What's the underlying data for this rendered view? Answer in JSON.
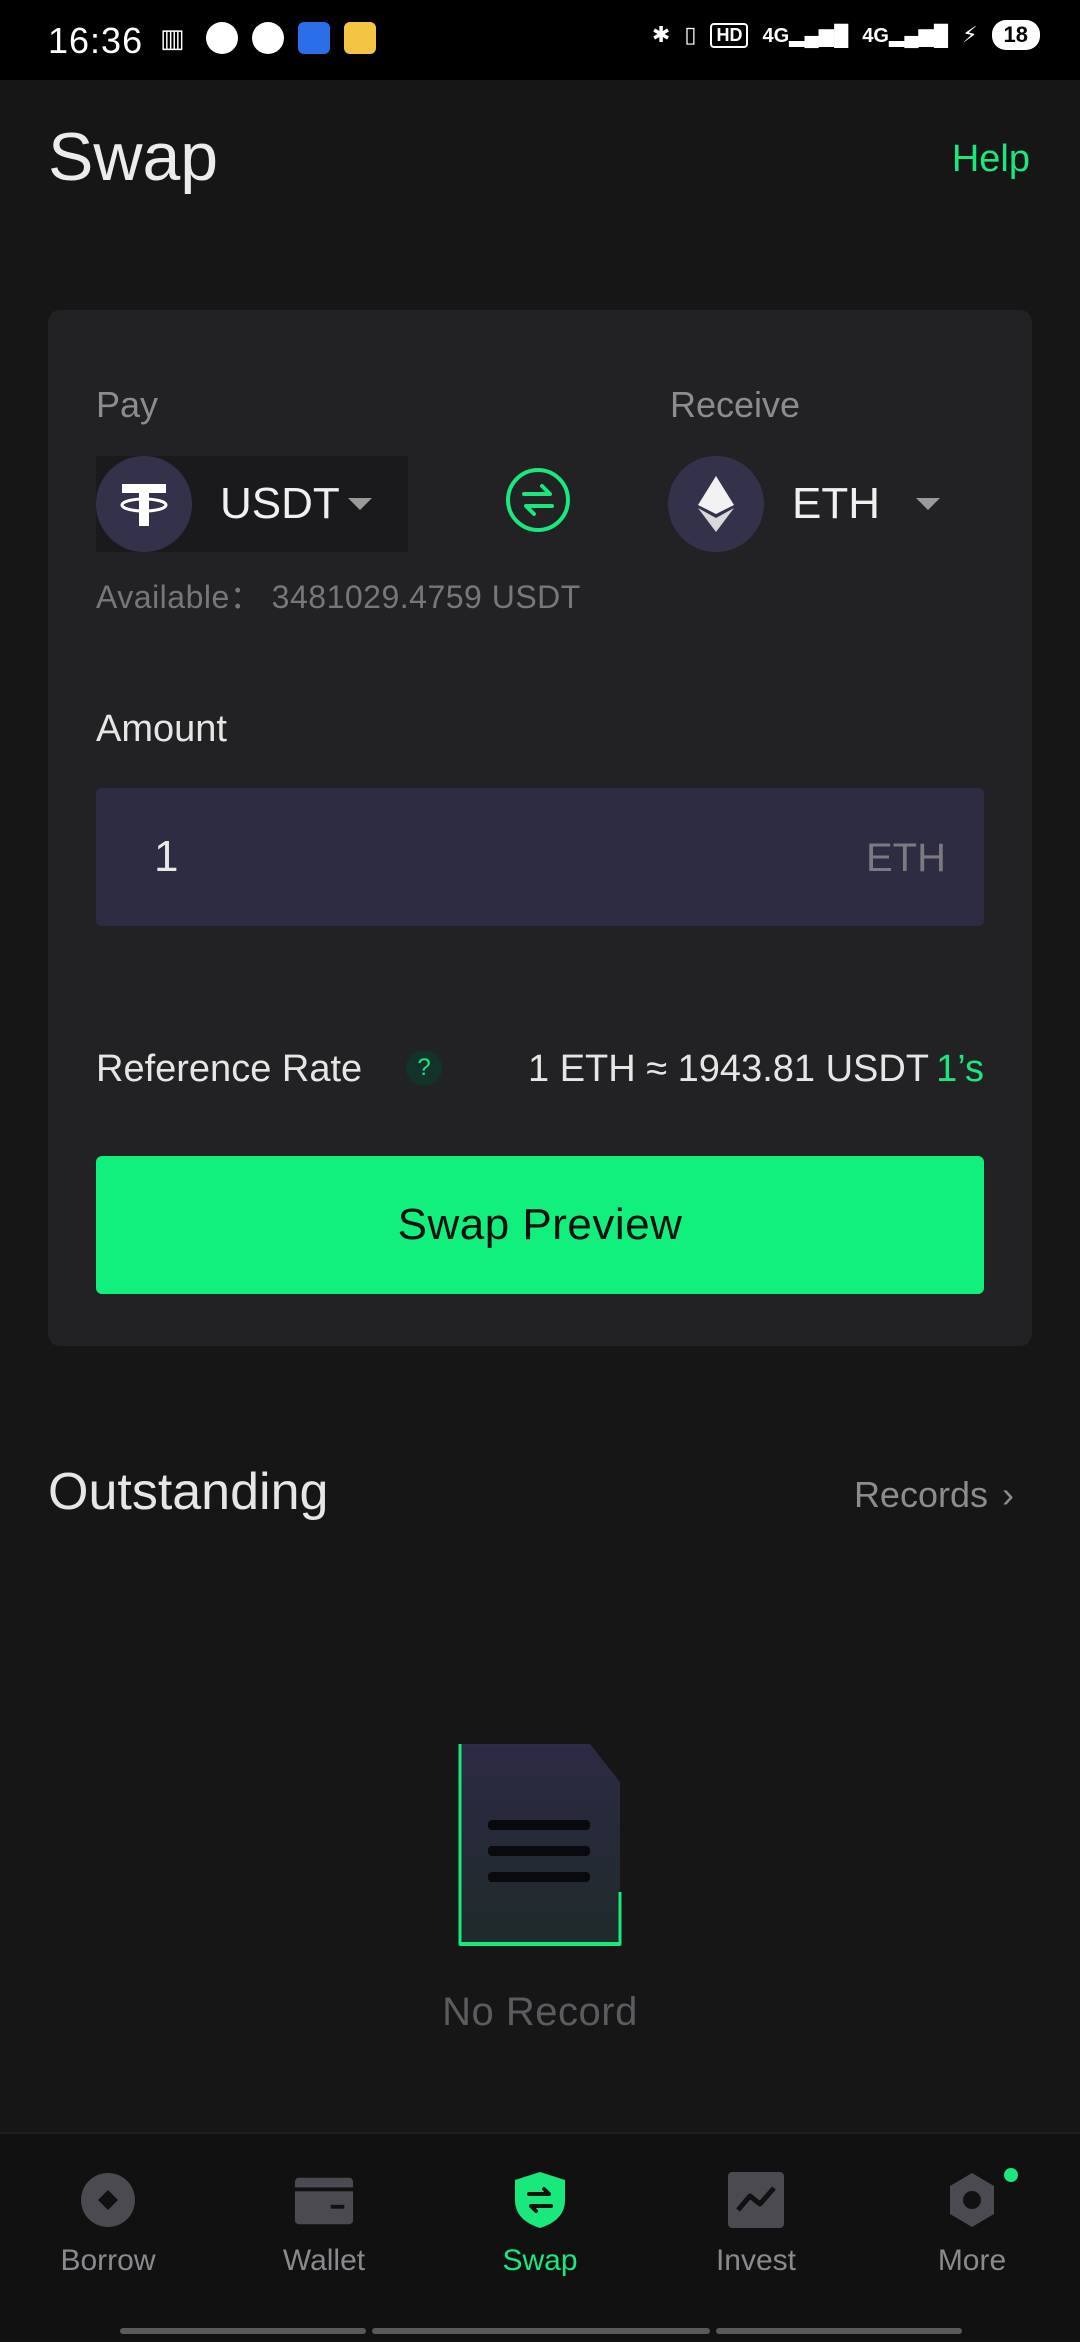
{
  "status_bar": {
    "time": "16:36",
    "network_1": "4G",
    "network_2": "4G",
    "battery": "18"
  },
  "header": {
    "title": "Swap",
    "help_label": "Help"
  },
  "swap_card": {
    "pay_label": "Pay",
    "receive_label": "Receive",
    "pay_token": "USDT",
    "receive_token": "ETH",
    "available_text": "Available： 3481029.4759 USDT",
    "amount_label": "Amount",
    "amount_value": "1",
    "amount_unit": "ETH",
    "rate_label": "Reference Rate",
    "rate_help": "?",
    "rate_value": "1 ETH ≈ 1943.81 USDT",
    "rate_timer": "1’s",
    "preview_button": "Swap Preview"
  },
  "outstanding": {
    "title": "Outstanding",
    "records_label": "Records",
    "empty_text": "No Record"
  },
  "bottom_nav": {
    "items": [
      {
        "label": "Borrow",
        "icon": "borrow-icon"
      },
      {
        "label": "Wallet",
        "icon": "wallet-icon"
      },
      {
        "label": "Swap",
        "icon": "swap-shield-icon"
      },
      {
        "label": "Invest",
        "icon": "invest-chart-icon"
      },
      {
        "label": "More",
        "icon": "gear-icon"
      }
    ],
    "active": "Swap"
  },
  "colors": {
    "accent": "#19e87d",
    "button": "#11f07c",
    "background": "#161616",
    "card": "#222224",
    "input": "#2e2c42"
  }
}
